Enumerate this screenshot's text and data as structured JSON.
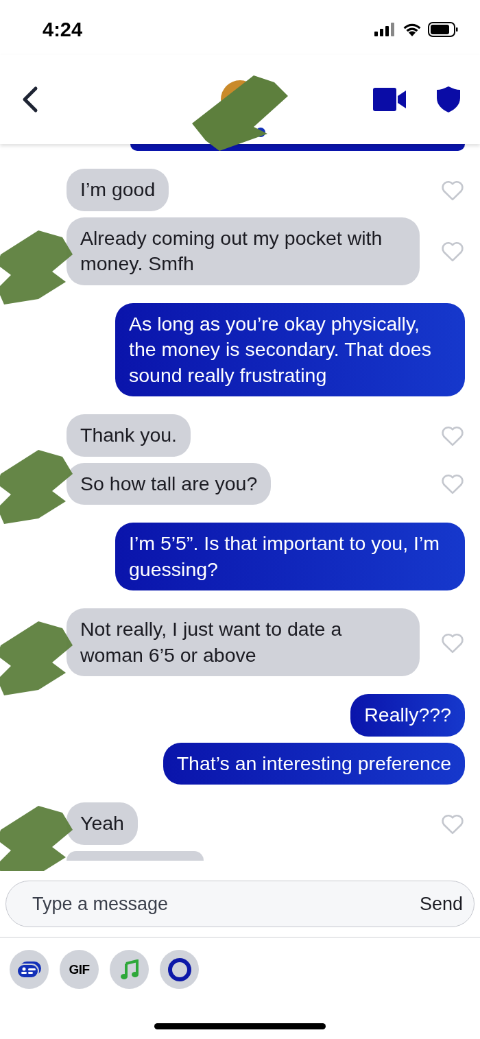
{
  "status_bar": {
    "time": "4:24"
  },
  "messages": [
    {
      "kind": "incoming",
      "bubbles": [
        {
          "text": "I’m good",
          "liked": false
        },
        {
          "text": "Already coming out my pocket with money. Smfh",
          "liked": false
        }
      ]
    },
    {
      "kind": "outgoing",
      "bubbles": [
        {
          "text": "As long as you’re okay physically, the money is secondary. That does sound really frustrating"
        }
      ]
    },
    {
      "kind": "incoming",
      "bubbles": [
        {
          "text": "Thank you.",
          "liked": false
        },
        {
          "text": "So how tall are you?",
          "liked": false
        }
      ]
    },
    {
      "kind": "outgoing",
      "bubbles": [
        {
          "text": "I’m 5’5”. Is that important to you, I’m guessing?"
        }
      ]
    },
    {
      "kind": "incoming",
      "bubbles": [
        {
          "text": "Not really, I just want to date a woman 6’5 or above",
          "liked": false
        }
      ]
    },
    {
      "kind": "outgoing",
      "bubbles": [
        {
          "text": "Really???"
        },
        {
          "text": "That’s an interesting preference"
        }
      ]
    },
    {
      "kind": "incoming",
      "bubbles": [
        {
          "text": "Yeah",
          "liked": false
        }
      ]
    }
  ],
  "composer": {
    "placeholder": "Type a message",
    "send": "Send"
  },
  "toolbar": [
    {
      "kind": "card"
    },
    {
      "kind": "gif",
      "label": "GIF"
    },
    {
      "kind": "music"
    },
    {
      "kind": "ring"
    }
  ]
}
